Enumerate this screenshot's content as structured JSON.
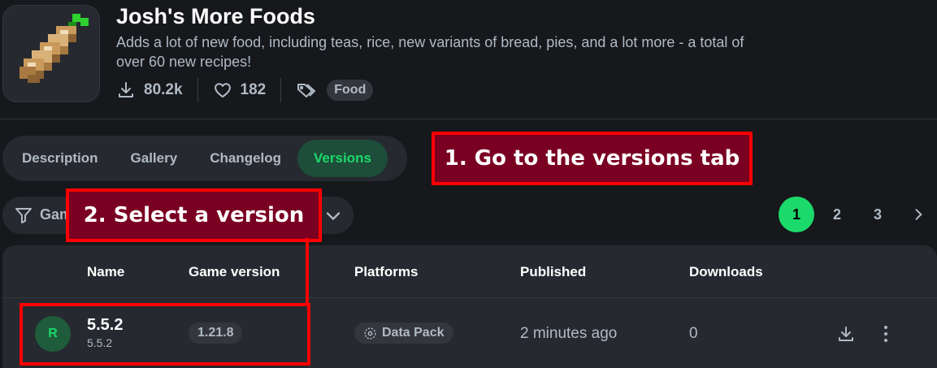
{
  "project": {
    "title": "Josh's More Foods",
    "summary": "Adds a lot of new food, including teas, rice, new variants of bread, pies, and a lot more - a total of over 60 new recipes!",
    "downloads": "80.2k",
    "follows": "182",
    "tag": "Food",
    "icon": "burrito-bread-icon"
  },
  "tabs": [
    {
      "label": "Description"
    },
    {
      "label": "Gallery"
    },
    {
      "label": "Changelog"
    },
    {
      "label": "Versions",
      "active": true
    }
  ],
  "annotations": {
    "step1": "1. Go to the versions tab",
    "step2": "2. Select a version"
  },
  "filter": {
    "label": "Gam"
  },
  "pagination": {
    "pages": [
      "1",
      "2",
      "3"
    ],
    "current": "1"
  },
  "table": {
    "headers": [
      "Name",
      "Game version",
      "Platforms",
      "Published",
      "Downloads"
    ],
    "rows": [
      {
        "channel_badge": "R",
        "name": "5.5.2",
        "version_number": "5.5.2",
        "game_version": "1.21.8",
        "platform": "Data Pack",
        "published": "2 minutes ago",
        "downloads": "0"
      }
    ]
  },
  "colors": {
    "background": "#16181c",
    "surface": "#26292f",
    "accent": "#1bd96a",
    "annotation_fill": "#7a0022",
    "annotation_border": "#ff0000"
  }
}
